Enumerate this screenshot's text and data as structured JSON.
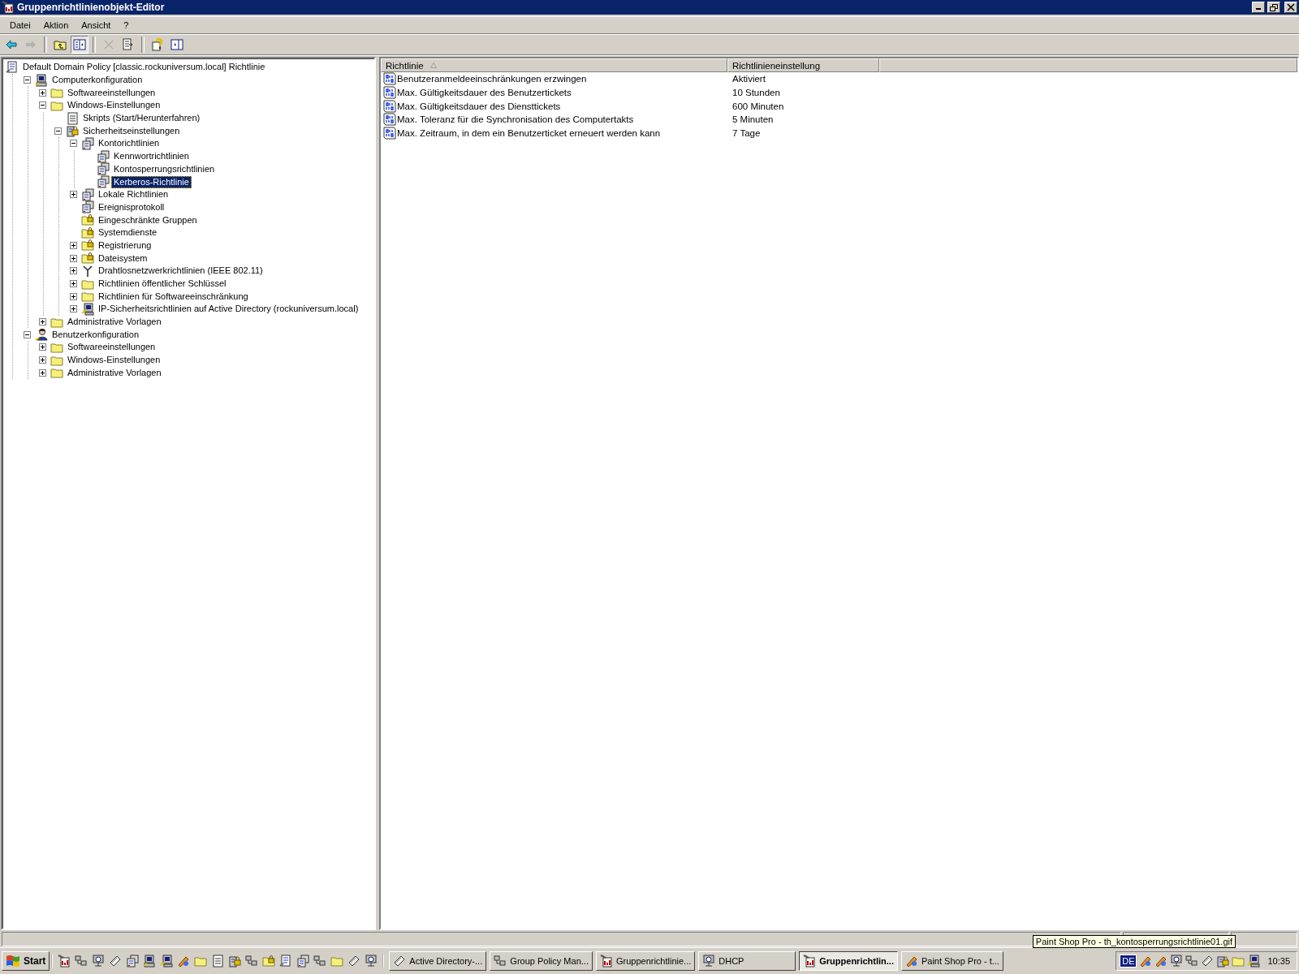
{
  "window": {
    "title": "Gruppenrichtlinienobjekt-Editor"
  },
  "menu": [
    {
      "label": "Datei"
    },
    {
      "label": "Aktion"
    },
    {
      "label": "Ansicht"
    },
    {
      "label": "?"
    }
  ],
  "toolbar": [
    {
      "kind": "back",
      "disabled": false,
      "pressed": false
    },
    {
      "kind": "forward",
      "disabled": true,
      "pressed": false
    },
    {
      "kind": "sep"
    },
    {
      "kind": "up",
      "disabled": false,
      "pressed": false
    },
    {
      "kind": "tree",
      "disabled": false,
      "pressed": true
    },
    {
      "kind": "sep"
    },
    {
      "kind": "delete",
      "disabled": true,
      "pressed": false
    },
    {
      "kind": "export",
      "disabled": false,
      "pressed": false
    },
    {
      "kind": "sep"
    },
    {
      "kind": "help",
      "disabled": false,
      "pressed": false
    },
    {
      "kind": "pane",
      "disabled": false,
      "pressed": false
    }
  ],
  "tree": [
    {
      "label": "Default Domain Policy [classic.rockuniversum.local] Richtlinie",
      "kind": "policy",
      "selected": false,
      "children": [
        {
          "label": "Computerkonfiguration",
          "kind": "computer",
          "expanded": true,
          "selected": false,
          "children": [
            {
              "label": "Softwareeinstellungen",
              "kind": "folder",
              "expanded": false,
              "selected": false
            },
            {
              "label": "Windows-Einstellungen",
              "kind": "folder",
              "expanded": true,
              "selected": false,
              "children": [
                {
                  "label": "Skripts (Start/Herunterfahren)",
                  "kind": "script",
                  "selected": false
                },
                {
                  "label": "Sicherheitseinstellungen",
                  "kind": "security",
                  "expanded": true,
                  "selected": false,
                  "children": [
                    {
                      "label": "Kontorichtlinien",
                      "kind": "servers",
                      "expanded": true,
                      "selected": false,
                      "children": [
                        {
                          "label": "Kennwortrichtlinien",
                          "kind": "servers",
                          "selected": false
                        },
                        {
                          "label": "Kontosperrungsrichtlinien",
                          "kind": "servers",
                          "selected": false
                        },
                        {
                          "label": "Kerberos-Richtlinie",
                          "kind": "servers",
                          "selected": true
                        }
                      ]
                    },
                    {
                      "label": "Lokale Richtlinien",
                      "kind": "servers",
                      "expanded": false,
                      "selected": false
                    },
                    {
                      "label": "Ereignisprotokoll",
                      "kind": "servers",
                      "selected": false
                    },
                    {
                      "label": "Eingeschränkte Gruppen",
                      "kind": "locked-folder",
                      "selected": false
                    },
                    {
                      "label": "Systemdienste",
                      "kind": "locked-folder",
                      "selected": false
                    },
                    {
                      "label": "Registrierung",
                      "kind": "locked-folder",
                      "expanded": false,
                      "selected": false
                    },
                    {
                      "label": "Dateisystem",
                      "kind": "locked-folder",
                      "expanded": false,
                      "selected": false
                    },
                    {
                      "label": "Drahtlosnetzwerkrichtlinien (IEEE 802.11)",
                      "kind": "antenna",
                      "expanded": false,
                      "selected": false
                    },
                    {
                      "label": "Richtlinien öffentlicher Schlüssel",
                      "kind": "folder",
                      "expanded": false,
                      "selected": false
                    },
                    {
                      "label": "Richtlinien für Softwareeinschränkung",
                      "kind": "folder",
                      "expanded": false,
                      "selected": false
                    },
                    {
                      "label": "IP-Sicherheitsrichtlinien auf Active Directory (rockuniversum.local)",
                      "kind": "ipsec",
                      "expanded": false,
                      "selected": false
                    }
                  ]
                }
              ]
            },
            {
              "label": "Administrative Vorlagen",
              "kind": "folder",
              "expanded": false,
              "selected": false
            }
          ]
        },
        {
          "label": "Benutzerkonfiguration",
          "kind": "user",
          "expanded": true,
          "selected": false,
          "children": [
            {
              "label": "Softwareeinstellungen",
              "kind": "folder",
              "expanded": false,
              "selected": false
            },
            {
              "label": "Windows-Einstellungen",
              "kind": "folder",
              "expanded": false,
              "selected": false
            },
            {
              "label": "Administrative Vorlagen",
              "kind": "folder",
              "expanded": false,
              "selected": false
            }
          ]
        }
      ]
    }
  ],
  "table": {
    "columns": [
      {
        "label": "Richtlinie",
        "sorted": true
      },
      {
        "label": "Richtlinieneinstellung",
        "sorted": false
      }
    ],
    "rows": [
      {
        "policy": "Benutzeranmeldeeinschränkungen erzwingen",
        "setting": "Aktiviert"
      },
      {
        "policy": "Max. Gültigkeitsdauer des Benutzertickets",
        "setting": "10 Stunden"
      },
      {
        "policy": "Max. Gültigkeitsdauer des Diensttickets",
        "setting": "600 Minuten"
      },
      {
        "policy": "Max. Toleranz für die Synchronisation des Computertakts",
        "setting": "5 Minuten"
      },
      {
        "policy": "Max. Zeitraum, in dem ein Benutzerticket erneuert werden kann",
        "setting": "7 Tage"
      }
    ]
  },
  "taskbar": {
    "start": "Start",
    "tasks": [
      {
        "label": "Active Directory-...",
        "kind": "ad",
        "selected": false
      },
      {
        "label": "Group Policy Man...",
        "kind": "gpm",
        "selected": false
      },
      {
        "label": "Gruppenrichtlinie...",
        "kind": "gpo",
        "selected": false
      },
      {
        "label": "DHCP",
        "kind": "dhcp",
        "selected": false
      },
      {
        "label": "Gruppenrichtlin...",
        "kind": "gpo",
        "selected": true
      },
      {
        "label": "Paint Shop Pro - t...",
        "kind": "psp",
        "selected": false
      }
    ],
    "language": "DE",
    "clock": "10:35",
    "tooltip": "Paint Shop Pro - th_kontosperrungsrichtlinie01.gif"
  }
}
